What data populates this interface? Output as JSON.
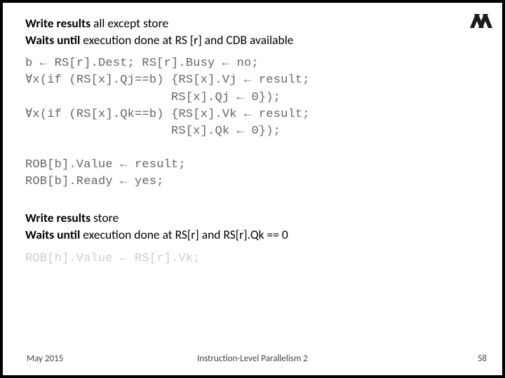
{
  "section1": {
    "line1_b": "Write results",
    "line1_rest": " all except store",
    "line2_b": "Waits until",
    "line2_rest": " execution done at RS [r] and CDB available",
    "code": "b ← RS[r].Dest; RS[r].Busy ← no;\n∀x(if (RS[x].Qj==b) {RS[x].Vj ← result;\n                    RS[x].Qj ← 0});\n∀x(if (RS[x].Qk==b) {RS[x].Vk ← result;\n                    RS[x].Qk ← 0});\n\nROB[b].Value ← result;\nROB[b].Ready ← yes;"
  },
  "section2": {
    "line1_b": "Write results",
    "line1_rest": " store",
    "line2_b": "Waits until",
    "line2_rest": " execution done at RS[r] and RS[r].Qk == 0",
    "code": "ROB[h].Value ← RS[r].Vk;"
  },
  "footer": {
    "date": "May 2015",
    "title": "Instruction-Level Parallelism 2",
    "page": "58"
  }
}
